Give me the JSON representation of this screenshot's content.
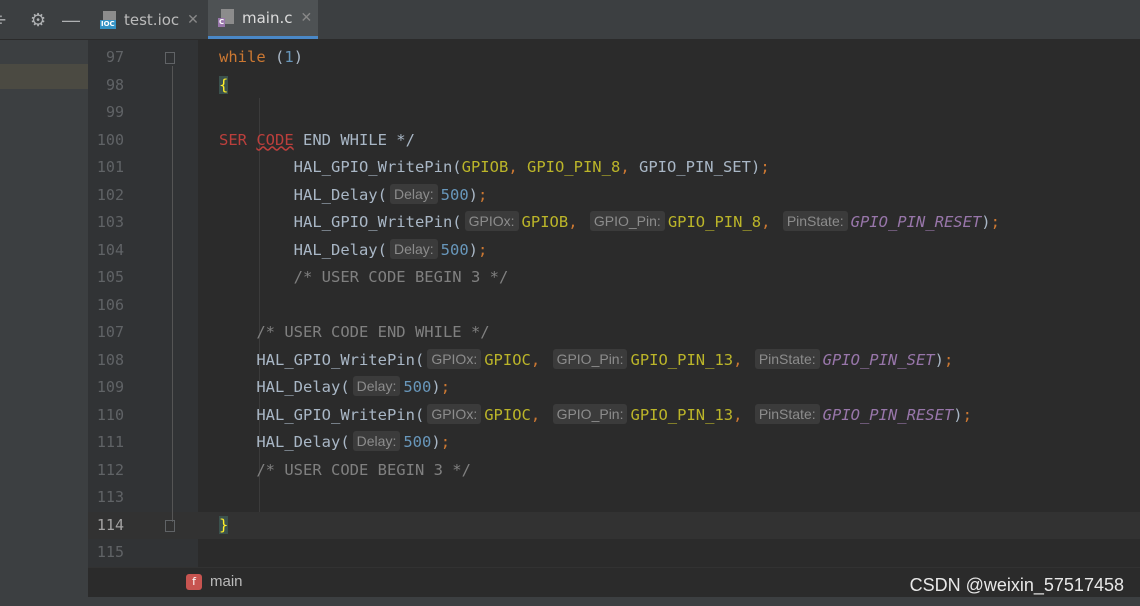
{
  "tabs": [
    {
      "label": "test.ioc",
      "icon": "ioc-file-icon",
      "icon_tag": "IOC",
      "icon_color": "#3592c4",
      "active": false
    },
    {
      "label": "main.c",
      "icon": "c-file-icon",
      "icon_tag": "C",
      "icon_color": "#9876aa",
      "active": true
    }
  ],
  "toolbar": {
    "collapse_icon": "collapse-icon",
    "settings_icon": "gear-icon",
    "hide_icon": "minus-icon"
  },
  "editor": {
    "current_line": "114",
    "lines": [
      {
        "n": "97",
        "parts": [
          {
            "c": "kw",
            "t": "while"
          },
          {
            "t": " ("
          },
          {
            "c": "num",
            "t": "1"
          },
          {
            "t": ")"
          }
        ]
      },
      {
        "n": "98",
        "parts": [
          {
            "c": "brace",
            "t": "{"
          }
        ]
      },
      {
        "n": "99",
        "parts": []
      },
      {
        "n": "100",
        "parts": [
          {
            "c": "err",
            "t": "SER "
          },
          {
            "c": "squig",
            "t": "CODE"
          },
          {
            "t": " END WHILE */"
          }
        ]
      },
      {
        "n": "101",
        "parts": [
          {
            "t": "        HAL_GPIO_WritePin("
          },
          {
            "c": "macro",
            "t": "GPIOB"
          },
          {
            "c": "kw",
            "t": ", "
          },
          {
            "c": "macro",
            "t": "GPIO_PIN_8"
          },
          {
            "c": "kw",
            "t": ", "
          },
          {
            "t": "GPIO_PIN_SET)"
          },
          {
            "c": "kw",
            "t": ";"
          }
        ]
      },
      {
        "n": "102",
        "parts": [
          {
            "t": "        HAL_Delay("
          },
          {
            "c": "hint",
            "t": "Delay:"
          },
          {
            "c": "num",
            "t": "500"
          },
          {
            "t": ")"
          },
          {
            "c": "kw",
            "t": ";"
          }
        ]
      },
      {
        "n": "103",
        "parts": [
          {
            "t": "        HAL_GPIO_WritePin("
          },
          {
            "c": "hint",
            "t": "GPIOx:"
          },
          {
            "c": "macro",
            "t": "GPIOB"
          },
          {
            "c": "kw",
            "t": ", "
          },
          {
            "c": "hint",
            "t": "GPIO_Pin:"
          },
          {
            "c": "macro",
            "t": "GPIO_PIN_8"
          },
          {
            "c": "kw",
            "t": ", "
          },
          {
            "c": "hint",
            "t": "PinState:"
          },
          {
            "c": "enumc",
            "t": "GPIO_PIN_RESET"
          },
          {
            "t": ")"
          },
          {
            "c": "kw",
            "t": ";"
          }
        ]
      },
      {
        "n": "104",
        "parts": [
          {
            "t": "        HAL_Delay("
          },
          {
            "c": "hint",
            "t": "Delay:"
          },
          {
            "c": "num",
            "t": "500"
          },
          {
            "t": ")"
          },
          {
            "c": "kw",
            "t": ";"
          }
        ]
      },
      {
        "n": "105",
        "parts": [
          {
            "c": "cmt",
            "t": "        /* USER CODE BEGIN 3 */"
          }
        ]
      },
      {
        "n": "106",
        "parts": []
      },
      {
        "n": "107",
        "parts": [
          {
            "c": "cmt",
            "t": "    /* USER CODE END WHILE */"
          }
        ]
      },
      {
        "n": "108",
        "parts": [
          {
            "t": "    HAL_GPIO_WritePin("
          },
          {
            "c": "hint",
            "t": "GPIOx:"
          },
          {
            "c": "macro",
            "t": "GPIOC"
          },
          {
            "c": "kw",
            "t": ", "
          },
          {
            "c": "hint",
            "t": "GPIO_Pin:"
          },
          {
            "c": "macro",
            "t": "GPIO_PIN_13"
          },
          {
            "c": "kw",
            "t": ", "
          },
          {
            "c": "hint",
            "t": "PinState:"
          },
          {
            "c": "enumc",
            "t": "GPIO_PIN_SET"
          },
          {
            "t": ")"
          },
          {
            "c": "kw",
            "t": ";"
          }
        ]
      },
      {
        "n": "109",
        "parts": [
          {
            "t": "    HAL_Delay("
          },
          {
            "c": "hint",
            "t": "Delay:"
          },
          {
            "c": "num",
            "t": "500"
          },
          {
            "t": ")"
          },
          {
            "c": "kw",
            "t": ";"
          }
        ]
      },
      {
        "n": "110",
        "parts": [
          {
            "t": "    HAL_GPIO_WritePin("
          },
          {
            "c": "hint",
            "t": "GPIOx:"
          },
          {
            "c": "macro",
            "t": "GPIOC"
          },
          {
            "c": "kw",
            "t": ", "
          },
          {
            "c": "hint",
            "t": "GPIO_Pin:"
          },
          {
            "c": "macro",
            "t": "GPIO_PIN_13"
          },
          {
            "c": "kw",
            "t": ", "
          },
          {
            "c": "hint",
            "t": "PinState:"
          },
          {
            "c": "enumc",
            "t": "GPIO_PIN_RESET"
          },
          {
            "t": ")"
          },
          {
            "c": "kw",
            "t": ";"
          }
        ]
      },
      {
        "n": "111",
        "parts": [
          {
            "t": "    HAL_Delay("
          },
          {
            "c": "hint",
            "t": "Delay:"
          },
          {
            "c": "num",
            "t": "500"
          },
          {
            "t": ")"
          },
          {
            "c": "kw",
            "t": ";"
          }
        ]
      },
      {
        "n": "112",
        "parts": [
          {
            "c": "cmt",
            "t": "    /* USER CODE BEGIN 3 */"
          }
        ]
      },
      {
        "n": "113",
        "parts": []
      },
      {
        "n": "114",
        "parts": [
          {
            "c": "brace",
            "t": "}"
          }
        ]
      },
      {
        "n": "115",
        "parts": []
      }
    ]
  },
  "breadcrumb": {
    "icon": "function-icon",
    "icon_letter": "f",
    "label": "main"
  },
  "watermark": "CSDN @weixin_57517458"
}
